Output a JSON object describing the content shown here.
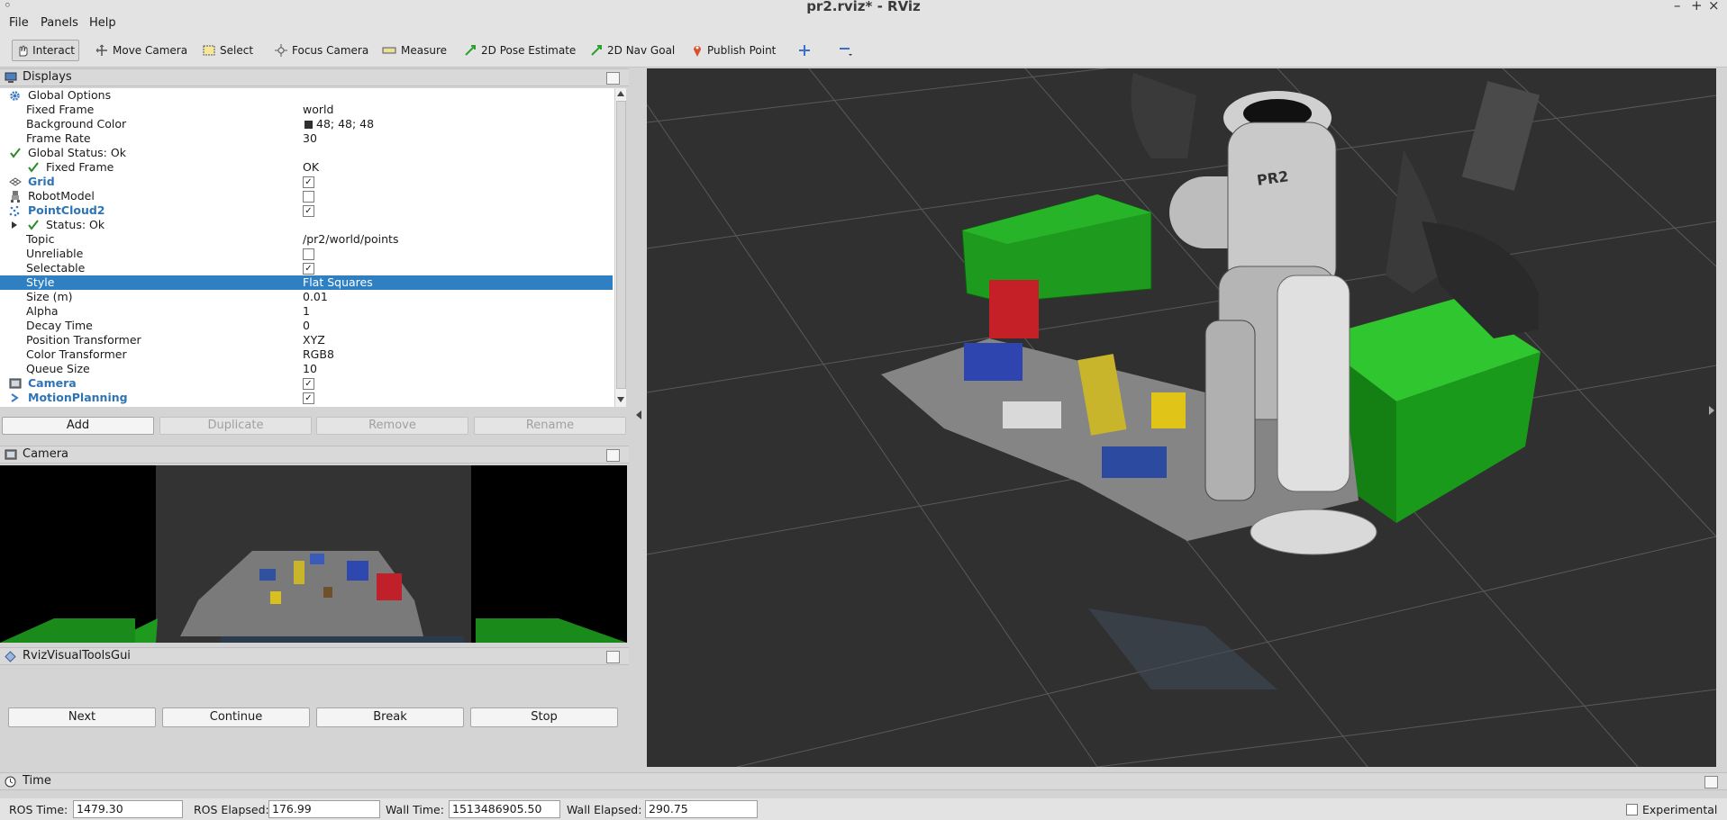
{
  "window": {
    "title": "pr2.rviz* - RViz"
  },
  "menu": {
    "file": "File",
    "panels": "Panels",
    "help": "Help"
  },
  "toolbar": {
    "interact": "Interact",
    "move_camera": "Move Camera",
    "select": "Select",
    "focus_camera": "Focus Camera",
    "measure": "Measure",
    "pose_estimate": "2D Pose Estimate",
    "nav_goal": "2D Nav Goal",
    "publish_point": "Publish Point"
  },
  "displays": {
    "title": "Displays",
    "rows": {
      "global_options": "Global Options",
      "fixed_frame": {
        "name": "Fixed Frame",
        "value": "world"
      },
      "background_color": {
        "name": "Background Color",
        "value": "48; 48; 48",
        "color": "#303030"
      },
      "frame_rate": {
        "name": "Frame Rate",
        "value": "30"
      },
      "global_status": "Global Status: Ok",
      "fixed_frame_status": {
        "name": "Fixed Frame",
        "value": "OK"
      },
      "grid": "Grid",
      "robot_model": "RobotModel",
      "pointcloud2": "PointCloud2",
      "status": "Status: Ok",
      "topic": {
        "name": "Topic",
        "value": "/pr2/world/points"
      },
      "unreliable": "Unreliable",
      "selectable": "Selectable",
      "style": {
        "name": "Style",
        "value": "Flat Squares"
      },
      "size": {
        "name": "Size (m)",
        "value": "0.01"
      },
      "alpha": {
        "name": "Alpha",
        "value": "1"
      },
      "decay_time": {
        "name": "Decay Time",
        "value": "0"
      },
      "position_transformer": {
        "name": "Position Transformer",
        "value": "XYZ"
      },
      "color_transformer": {
        "name": "Color Transformer",
        "value": "RGB8"
      },
      "queue_size": {
        "name": "Queue Size",
        "value": "10"
      },
      "camera": "Camera",
      "motion_planning": "MotionPlanning"
    },
    "buttons": {
      "add": "Add",
      "duplicate": "Duplicate",
      "remove": "Remove",
      "rename": "Rename"
    }
  },
  "camera_panel": {
    "title": "Camera"
  },
  "visual_tools": {
    "title": "RvizVisualToolsGui",
    "next": "Next",
    "continue": "Continue",
    "break": "Break",
    "stop": "Stop"
  },
  "time_panel": {
    "title": "Time",
    "ros_time_label": "ROS Time:",
    "ros_time": "1479.30",
    "ros_elapsed_label": "ROS Elapsed:",
    "ros_elapsed": "176.99",
    "wall_time_label": "Wall Time:",
    "wall_time": "1513486905.50",
    "wall_elapsed_label": "Wall Elapsed:",
    "wall_elapsed": "290.75",
    "experimental": "Experimental"
  },
  "robot_label": "PR2",
  "colors": {
    "selection": "#2f7fc3",
    "display_name": "#2e74b5",
    "viewport_bg": "#303030",
    "table_green": "#1fa01f"
  }
}
